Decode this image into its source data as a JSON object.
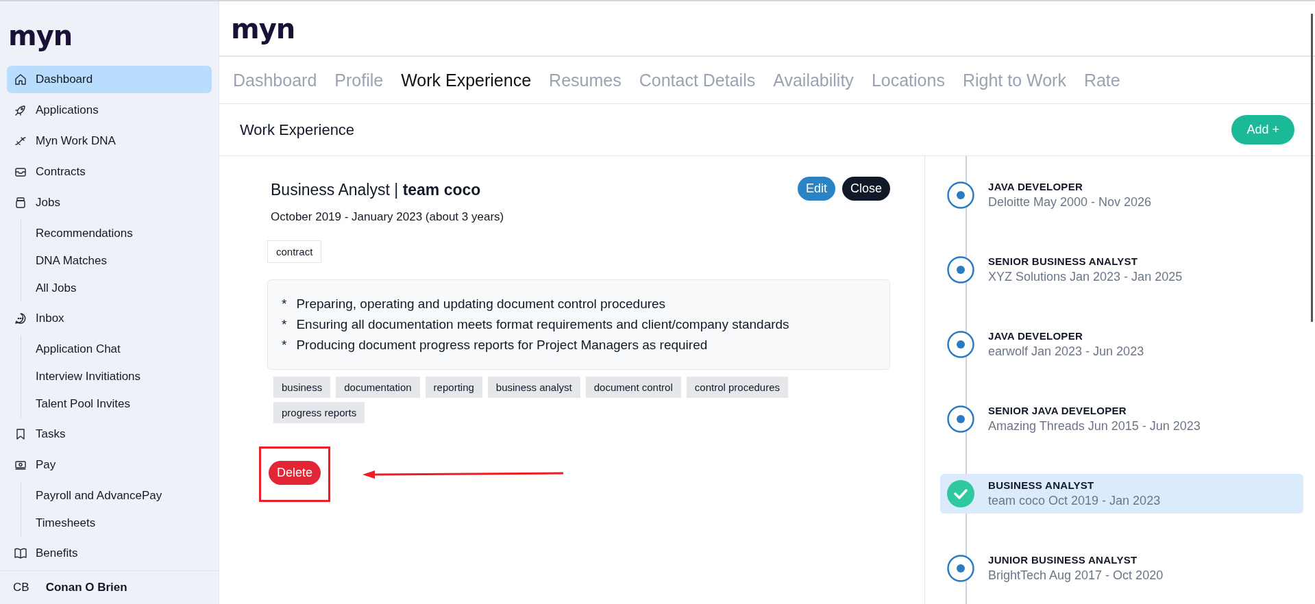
{
  "sidebar": {
    "logo": "myn",
    "items": [
      {
        "label": "Dashboard",
        "selected": true
      },
      {
        "label": "Applications",
        "selected": false
      },
      {
        "label": "Myn Work DNA",
        "selected": false
      },
      {
        "label": "Contracts",
        "selected": false
      },
      {
        "label": "Jobs",
        "selected": false,
        "children": [
          {
            "label": "Recommendations"
          },
          {
            "label": "DNA Matches"
          },
          {
            "label": "All Jobs"
          }
        ]
      },
      {
        "label": "Inbox",
        "selected": false,
        "children": [
          {
            "label": "Application Chat"
          },
          {
            "label": "Interview Invitiations"
          },
          {
            "label": "Talent Pool Invites"
          }
        ]
      },
      {
        "label": "Tasks",
        "selected": false
      },
      {
        "label": "Pay",
        "selected": false,
        "children": [
          {
            "label": "Payroll and AdvancePay"
          },
          {
            "label": "Timesheets"
          }
        ]
      },
      {
        "label": "Benefits",
        "selected": false
      }
    ],
    "user": {
      "initials": "CB",
      "name": "Conan O Brien"
    }
  },
  "header": {
    "logo": "myn"
  },
  "tabs": [
    {
      "label": "Dashboard",
      "selected": false
    },
    {
      "label": "Profile",
      "selected": false
    },
    {
      "label": "Work Experience",
      "selected": true
    },
    {
      "label": "Resumes",
      "selected": false
    },
    {
      "label": "Contact Details",
      "selected": false
    },
    {
      "label": "Availability",
      "selected": false
    },
    {
      "label": "Locations",
      "selected": false
    },
    {
      "label": "Right to Work",
      "selected": false
    },
    {
      "label": "Rate",
      "selected": false
    }
  ],
  "section": {
    "title": "Work Experience",
    "add_button": "Add +"
  },
  "detail": {
    "title": "Business Analyst | **team coco**",
    "edit_button": "Edit",
    "close_button": "Close",
    "dates": "October 2019 - January 2023 (about 3 years)",
    "type_tag": "contract",
    "bullets": [
      {
        "mark": "*",
        "text": "Preparing, operating and updating document control procedures"
      },
      {
        "mark": "*",
        "text": "Ensuring all documentation meets format requirements and client/company standards"
      },
      {
        "mark": "*",
        "text": "Producing document progress reports for Project Managers as required"
      }
    ],
    "skills": [
      "business",
      "documentation",
      "reporting",
      "business analyst",
      "document control",
      "control procedures",
      "progress reports"
    ],
    "delete_button": "Delete"
  },
  "timeline": [
    {
      "title": "JAVA DEVELOPER",
      "subtitle": "Deloitte May 2000 - Nov 2026",
      "selected": false
    },
    {
      "title": "SENIOR BUSINESS ANALYST",
      "subtitle": "XYZ Solutions Jan 2023 - Jan 2025",
      "selected": false
    },
    {
      "title": "JAVA DEVELOPER",
      "subtitle": "earwolf Jan 2023 - Jun 2023",
      "selected": false
    },
    {
      "title": "SENIOR JAVA DEVELOPER",
      "subtitle": "Amazing Threads Jun 2015 - Jun 2023",
      "selected": false
    },
    {
      "title": "BUSINESS ANALYST",
      "subtitle": "team coco Oct 2019 - Jan 2023",
      "selected": true
    },
    {
      "title": "JUNIOR BUSINESS ANALYST",
      "subtitle": "BrightTech Aug 2017 - Oct 2020",
      "selected": false
    }
  ]
}
